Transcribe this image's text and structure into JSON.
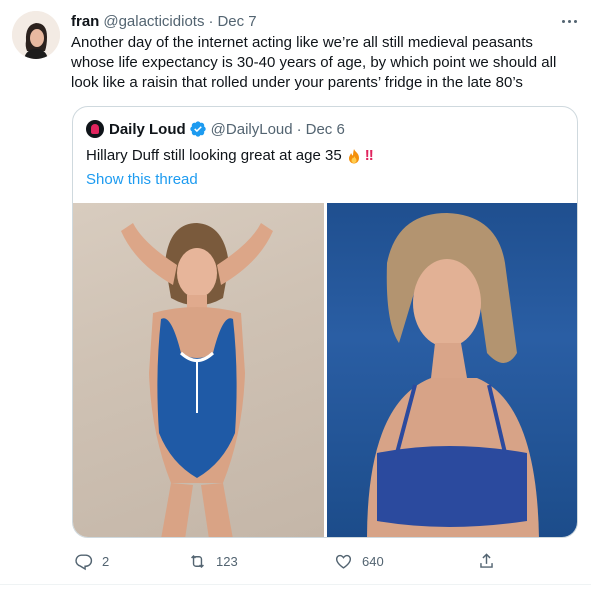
{
  "tweet": {
    "name": "fran",
    "handle": "@galacticidiots",
    "dot": "·",
    "date": "Dec 7",
    "text": "Another day of the internet acting like we’re all still medieval peasants whose life expectancy is 30-40 years of age, by which point we should all look like a raisin that rolled under your parents’ fridge in the late 80’s"
  },
  "quote": {
    "name": "Daily Loud",
    "handle": "@DailyLoud",
    "dot": "·",
    "date": "Dec 6",
    "text": "Hillary Duff still looking great at age 35",
    "bang": "!!",
    "show_thread": "Show this thread",
    "verified_color": "#1d9bf0"
  },
  "actions": {
    "reply_count": "2",
    "retweet_count": "123",
    "like_count": "640"
  },
  "icons": [
    "more-icon",
    "verified-icon",
    "fire-emoji",
    "reply-icon",
    "retweet-icon",
    "like-icon",
    "share-icon"
  ]
}
